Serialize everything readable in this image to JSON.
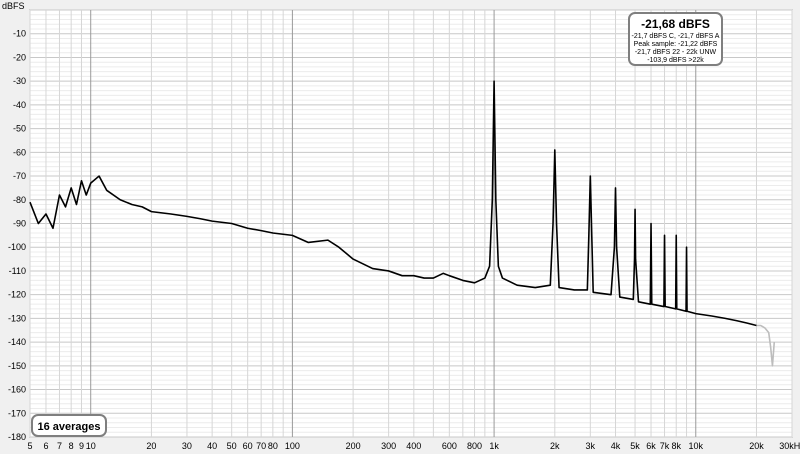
{
  "chart_data": {
    "type": "line",
    "title": "",
    "xlabel": "",
    "ylabel": "dBFS",
    "x_unit_label": "",
    "x_scale": "log",
    "xlim": [
      5,
      30000
    ],
    "ylim": [
      -180,
      0
    ],
    "grid": true,
    "y_ticks": [
      -10,
      -20,
      -30,
      -40,
      -50,
      -60,
      -70,
      -80,
      -90,
      -100,
      -110,
      -120,
      -130,
      -140,
      -150,
      -160,
      -170,
      -180
    ],
    "x_ticks": [
      {
        "value": 5,
        "label": "5"
      },
      {
        "value": 6,
        "label": "6"
      },
      {
        "value": 7,
        "label": "7"
      },
      {
        "value": 8,
        "label": "8"
      },
      {
        "value": 9,
        "label": "9"
      },
      {
        "value": 10,
        "label": "10"
      },
      {
        "value": 20,
        "label": "20"
      },
      {
        "value": 30,
        "label": "30"
      },
      {
        "value": 40,
        "label": "40"
      },
      {
        "value": 50,
        "label": "50"
      },
      {
        "value": 60,
        "label": "60"
      },
      {
        "value": 70,
        "label": "70"
      },
      {
        "value": 80,
        "label": "80"
      },
      {
        "value": 100,
        "label": "100"
      },
      {
        "value": 200,
        "label": "200"
      },
      {
        "value": 300,
        "label": "300"
      },
      {
        "value": 400,
        "label": "400"
      },
      {
        "value": 600,
        "label": "600"
      },
      {
        "value": 800,
        "label": "800"
      },
      {
        "value": 1000,
        "label": "1k"
      },
      {
        "value": 2000,
        "label": "2k"
      },
      {
        "value": 3000,
        "label": "3k"
      },
      {
        "value": 4000,
        "label": "4k"
      },
      {
        "value": 5000,
        "label": "5k"
      },
      {
        "value": 6000,
        "label": "6k"
      },
      {
        "value": 7000,
        "label": "7k"
      },
      {
        "value": 8000,
        "label": "8k"
      },
      {
        "value": 10000,
        "label": "10k"
      },
      {
        "value": 20000,
        "label": "20k"
      },
      {
        "value": 30000,
        "label": "30kHz"
      }
    ],
    "series": [
      {
        "color": "#000000",
        "points": [
          [
            5,
            -81
          ],
          [
            5.5,
            -90
          ],
          [
            6,
            -86
          ],
          [
            6.5,
            -92
          ],
          [
            7,
            -78
          ],
          [
            7.5,
            -83
          ],
          [
            8,
            -75
          ],
          [
            8.5,
            -82
          ],
          [
            9,
            -72
          ],
          [
            9.5,
            -78
          ],
          [
            10,
            -73
          ],
          [
            11,
            -70
          ],
          [
            12,
            -76
          ],
          [
            14,
            -80
          ],
          [
            16,
            -82
          ],
          [
            18,
            -83
          ],
          [
            20,
            -85
          ],
          [
            25,
            -86
          ],
          [
            30,
            -87
          ],
          [
            35,
            -88
          ],
          [
            40,
            -89
          ],
          [
            50,
            -90
          ],
          [
            60,
            -92
          ],
          [
            70,
            -93
          ],
          [
            80,
            -94
          ],
          [
            100,
            -95
          ],
          [
            120,
            -98
          ],
          [
            150,
            -97
          ],
          [
            170,
            -100
          ],
          [
            200,
            -105
          ],
          [
            250,
            -109
          ],
          [
            300,
            -110
          ],
          [
            350,
            -112
          ],
          [
            400,
            -112
          ],
          [
            450,
            -113
          ],
          [
            500,
            -113
          ],
          [
            560,
            -111
          ],
          [
            600,
            -112
          ],
          [
            700,
            -114
          ],
          [
            800,
            -115
          ],
          [
            900,
            -113
          ],
          [
            950,
            -108
          ],
          [
            980,
            -80
          ],
          [
            1000,
            -30
          ],
          [
            1020,
            -80
          ],
          [
            1050,
            -108
          ],
          [
            1100,
            -113
          ],
          [
            1300,
            -116
          ],
          [
            1600,
            -117
          ],
          [
            1900,
            -116
          ],
          [
            1960,
            -90
          ],
          [
            2000,
            -59
          ],
          [
            2040,
            -90
          ],
          [
            2100,
            -117
          ],
          [
            2500,
            -118
          ],
          [
            2900,
            -118
          ],
          [
            2950,
            -95
          ],
          [
            3000,
            -70
          ],
          [
            3050,
            -95
          ],
          [
            3100,
            -119
          ],
          [
            3800,
            -120
          ],
          [
            3950,
            -100
          ],
          [
            4000,
            -75
          ],
          [
            4050,
            -100
          ],
          [
            4200,
            -121
          ],
          [
            4900,
            -122
          ],
          [
            4970,
            -105
          ],
          [
            5000,
            -84
          ],
          [
            5030,
            -105
          ],
          [
            5200,
            -123
          ],
          [
            5950,
            -124
          ],
          [
            6000,
            -90
          ],
          [
            6050,
            -124
          ],
          [
            6950,
            -125
          ],
          [
            7000,
            -95
          ],
          [
            7050,
            -125
          ],
          [
            7950,
            -126
          ],
          [
            8000,
            -95
          ],
          [
            8050,
            -126
          ],
          [
            8950,
            -127
          ],
          [
            9000,
            -100
          ],
          [
            9050,
            -127
          ],
          [
            10000,
            -128
          ],
          [
            12000,
            -129
          ],
          [
            14000,
            -130
          ],
          [
            16000,
            -131
          ],
          [
            18000,
            -132
          ],
          [
            20000,
            -133
          ]
        ]
      },
      {
        "color": "#bdbdbd",
        "points": [
          [
            20000,
            -133
          ],
          [
            21000,
            -133
          ],
          [
            22000,
            -134
          ],
          [
            23000,
            -136
          ],
          [
            23500,
            -142
          ],
          [
            24000,
            -150
          ],
          [
            24500,
            -140
          ]
        ]
      }
    ]
  },
  "readout": {
    "main": "-21,68 dBFS",
    "lines": [
      "-21,7 dBFS C, -21,7 dBFS A",
      "Peak sample: -21,22 dBFS",
      "-21,7 dBFS 22 - 22k UNW",
      "-103,9 dBFS >22k"
    ]
  },
  "averages_label": "16 averages"
}
